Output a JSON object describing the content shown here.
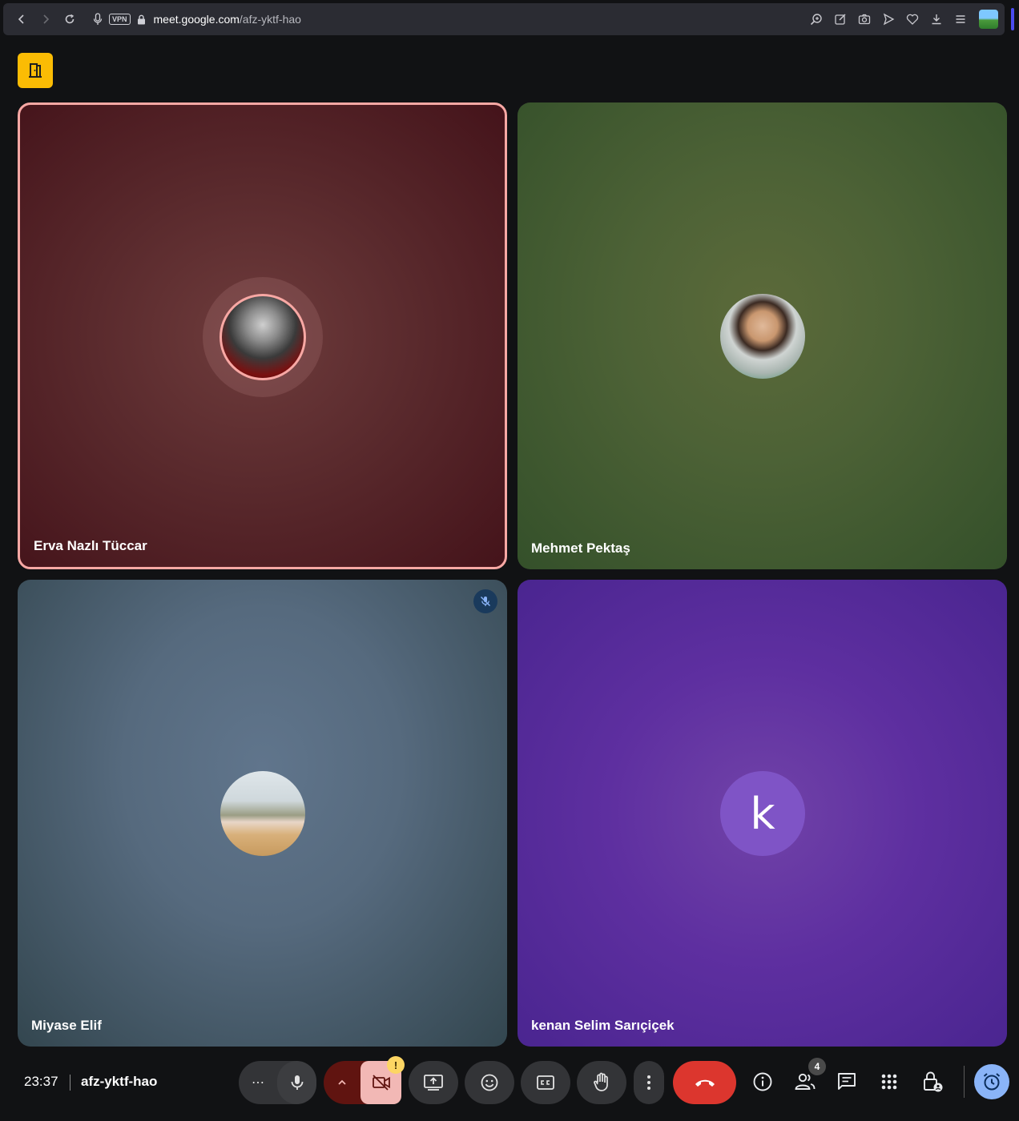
{
  "browser": {
    "url_domain": "meet.google.com",
    "url_path": "/afz-yktf-hao",
    "vpn_label": "VPN"
  },
  "tiles": [
    {
      "name": "Erva Nazlı Tüccar",
      "speaking": true
    },
    {
      "name": "Mehmet Pektaş"
    },
    {
      "name": "Miyase Elif",
      "muted": true
    },
    {
      "name": "kenan Selim Sarıçiçek",
      "initial": "k"
    }
  ],
  "bottom_bar": {
    "time": "23:37",
    "meeting_code": "afz-yktf-hao",
    "more_label": "⋯",
    "camera_warning": "!",
    "people_count": "4"
  },
  "colors": {
    "speaking_border": "#f8a8a4",
    "end_call": "#e53935",
    "camera_off": "#f2b8b5",
    "accent": "#8ab4f8"
  }
}
